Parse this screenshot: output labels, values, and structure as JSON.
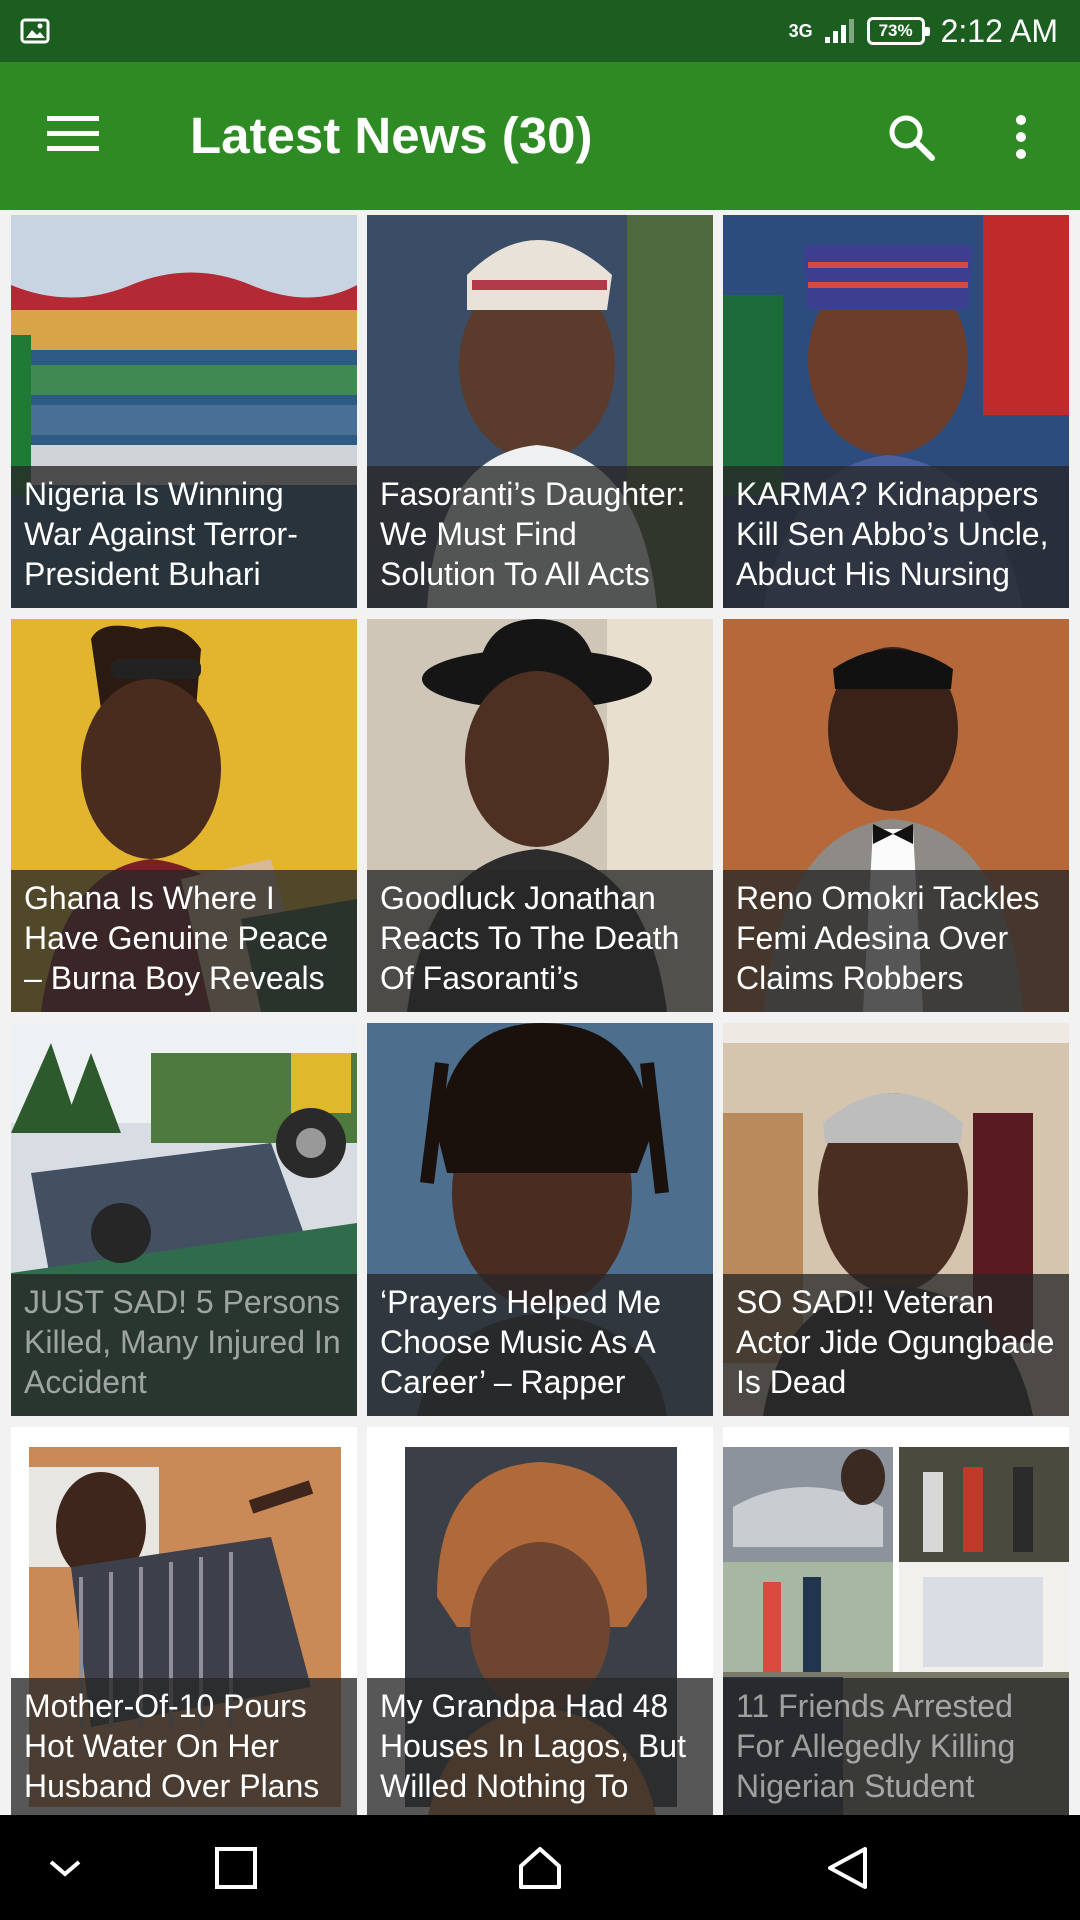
{
  "status_bar": {
    "network_label": "3G",
    "battery_percent": "73%",
    "time": "2:12 AM",
    "icons": [
      "gallery-notification-icon",
      "signal-icon",
      "battery-icon"
    ]
  },
  "app_bar": {
    "title": "Latest News (30)",
    "icons": [
      "menu-icon",
      "search-icon",
      "more-vert-icon"
    ]
  },
  "colors": {
    "status_bar": "#1b5e20",
    "app_bar": "#2e8b23",
    "caption_overlay": "#282828",
    "nav_bar": "#000000"
  },
  "articles": [
    {
      "caption": "Nigeria Is Winning War Against Terror- President Buhari",
      "faded": false
    },
    {
      "caption": "Fasoranti’s Daughter: We Must Find Solution To All Acts",
      "faded": false
    },
    {
      "caption": "KARMA? Kidnappers Kill Sen Abbo’s Uncle, Abduct His Nursing",
      "faded": false
    },
    {
      "caption": "Ghana Is Where I Have Genuine Peace – Burna Boy Reveals",
      "faded": false
    },
    {
      "caption": "Goodluck Jonathan Reacts To The Death Of Fasoranti’s",
      "faded": false
    },
    {
      "caption": "Reno Omokri Tackles Femi Adesina Over Claims Robbers",
      "faded": false
    },
    {
      "caption": "JUST SAD! 5 Persons Killed, Many Injured In Accident",
      "faded": true
    },
    {
      "caption": "‘Prayers Helped Me Choose Music As A Career’ – Rapper",
      "faded": false
    },
    {
      "caption": "SO SAD!! Veteran Actor Jide Ogungbade Is Dead",
      "faded": false
    },
    {
      "caption": "Mother-Of-10 Pours Hot Water On Her Husband Over Plans",
      "faded": false
    },
    {
      "caption": "My Grandpa Had 48 Houses In Lagos, But Willed Nothing To",
      "faded": false
    },
    {
      "caption": "11 Friends Arrested For Allegedly Killing Nigerian Student",
      "faded": true
    }
  ],
  "nav_bar": {
    "icons": [
      "collapse-chevron-icon",
      "recents-square-icon",
      "home-icon",
      "back-triangle-icon"
    ]
  }
}
